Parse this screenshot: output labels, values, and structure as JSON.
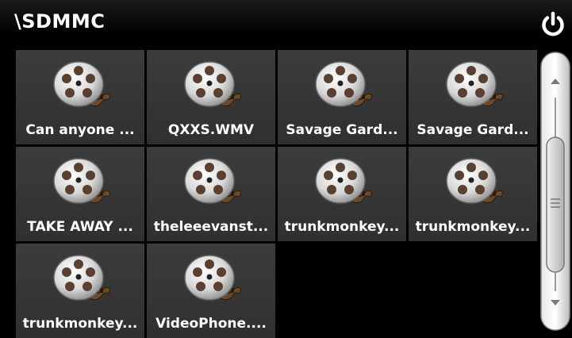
{
  "header": {
    "title": "\\SDMMC"
  },
  "files": [
    {
      "label": "Can anyone ..."
    },
    {
      "label": "QXXS.WMV"
    },
    {
      "label": "Savage Gard..."
    },
    {
      "label": "Savage Gard..."
    },
    {
      "label": "TAKE AWAY ..."
    },
    {
      "label": "theleeevanst..."
    },
    {
      "label": "trunkmonkey..."
    },
    {
      "label": "trunkmonkey..."
    },
    {
      "label": "trunkmonkey..."
    },
    {
      "label": "VideoPhone...."
    }
  ],
  "icons": {
    "power": "power-icon",
    "file": "film-reel-icon",
    "scroll_up": "arrow-up-icon",
    "scroll_down": "arrow-down-icon"
  },
  "colors": {
    "tile": "#363636",
    "background": "#000000",
    "text": "#ffffff"
  }
}
